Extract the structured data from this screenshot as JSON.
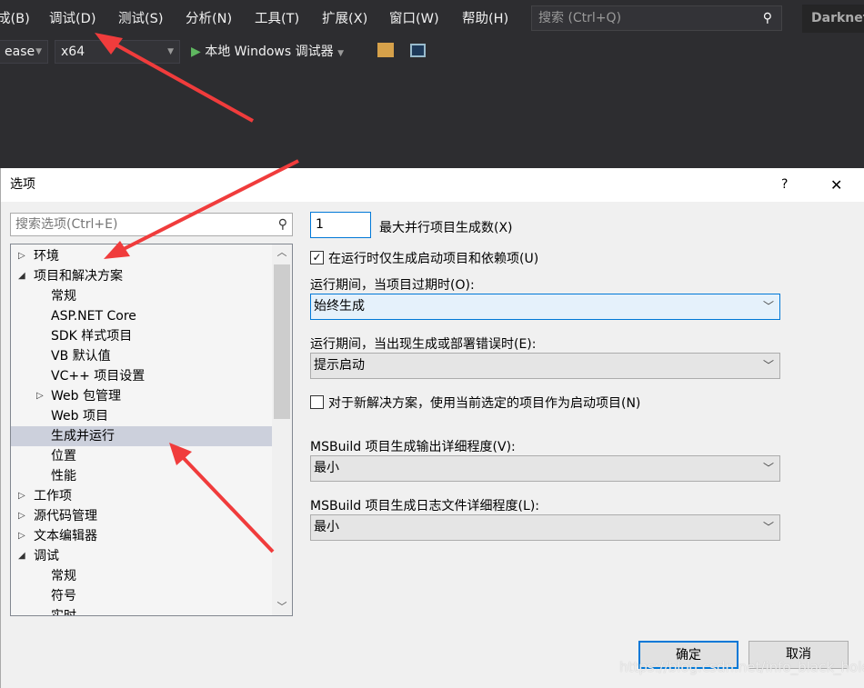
{
  "menu": [
    "成(B)",
    "调试(D)",
    "测试(S)",
    "分析(N)",
    "工具(T)",
    "扩展(X)",
    "窗口(W)",
    "帮助(H)"
  ],
  "search_placeholder": "搜索 (Ctrl+Q)",
  "project": "Darknet",
  "toolbar": {
    "config": "ease",
    "platform": "x64",
    "debugger": "本地 Windows 调试器"
  },
  "dialog": {
    "title": "选项",
    "help": "?",
    "close": "✕",
    "search_placeholder": "搜索选项(Ctrl+E)",
    "tree": [
      {
        "label": "环境",
        "level": 0,
        "exp": "right"
      },
      {
        "label": "项目和解决方案",
        "level": 0,
        "exp": "down"
      },
      {
        "label": "常规",
        "level": 1
      },
      {
        "label": "ASP.NET Core",
        "level": 1
      },
      {
        "label": "SDK 样式项目",
        "level": 1
      },
      {
        "label": "VB 默认值",
        "level": 1
      },
      {
        "label": "VC++ 项目设置",
        "level": 1
      },
      {
        "label": "Web 包管理",
        "level": 1,
        "exp": "right"
      },
      {
        "label": "Web 项目",
        "level": 1
      },
      {
        "label": "生成并运行",
        "level": 1,
        "selected": true
      },
      {
        "label": "位置",
        "level": 1
      },
      {
        "label": "性能",
        "level": 1
      },
      {
        "label": "工作项",
        "level": 0,
        "exp": "right"
      },
      {
        "label": "源代码管理",
        "level": 0,
        "exp": "right"
      },
      {
        "label": "文本编辑器",
        "level": 0,
        "exp": "right"
      },
      {
        "label": "调试",
        "level": 0,
        "exp": "down"
      },
      {
        "label": "常规",
        "level": 1
      },
      {
        "label": "符号",
        "level": 1
      },
      {
        "label": "实时",
        "level": 1
      }
    ],
    "max_parallel_value": "1",
    "max_parallel_label": "最大并行项目生成数(X)",
    "only_build_startup_label": "在运行时仅生成启动项目和依赖项(U)",
    "only_build_startup_checked": true,
    "outdated_label": "运行期间，当项目过期时(O):",
    "outdated_value": "始终生成",
    "error_label": "运行期间，当出现生成或部署错误时(E):",
    "error_value": "提示启动",
    "new_solution_label": "对于新解决方案，使用当前选定的项目作为启动项目(N)",
    "new_solution_checked": false,
    "msbuild_output_label": "MSBuild 项目生成输出详细程度(V):",
    "msbuild_output_value": "最小",
    "msbuild_log_label": "MSBuild 项目生成日志文件详细程度(L):",
    "msbuild_log_value": "最小",
    "ok": "确定",
    "cancel": "取消"
  },
  "watermark": "https://blog.csdn.net/info_black_hole",
  "colors": {
    "accent": "#0078d7",
    "arrow": "#f03c3c",
    "dark_bg": "#2d2d30"
  }
}
